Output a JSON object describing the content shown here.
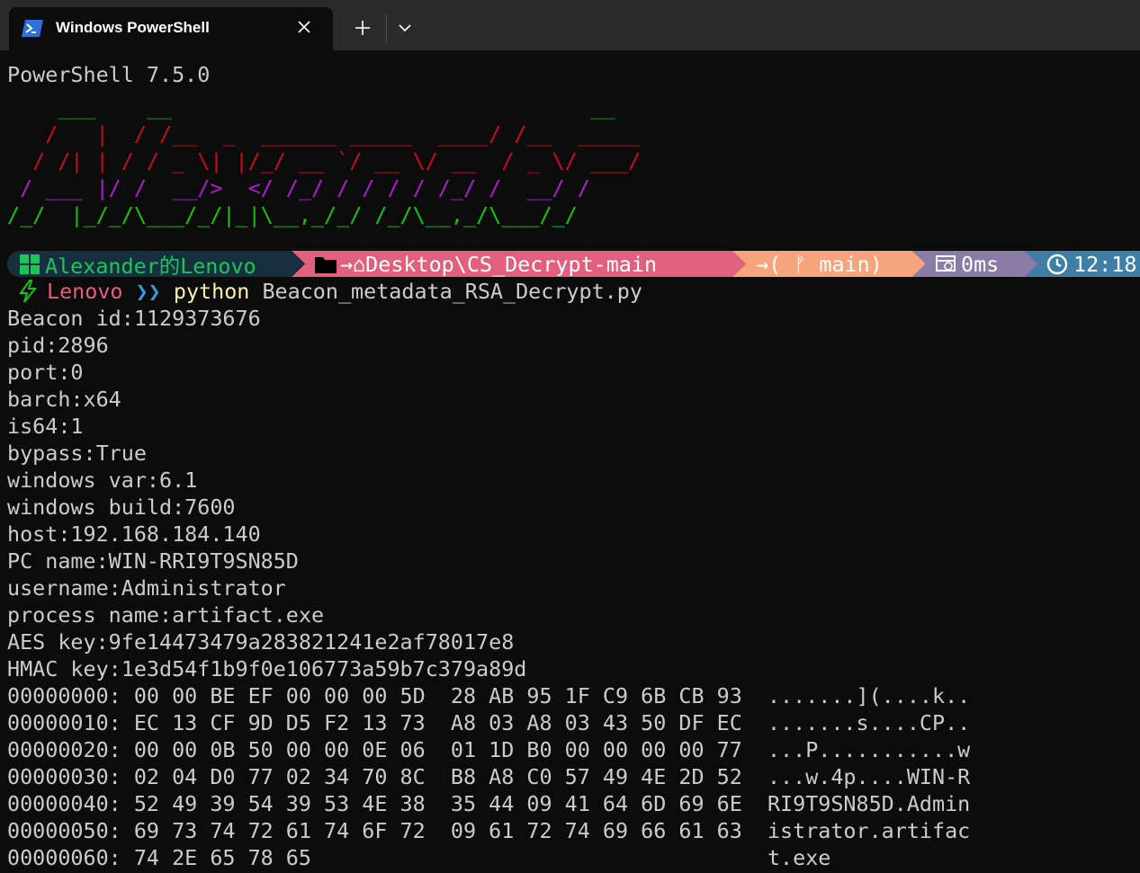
{
  "window": {
    "tab_title": "Windows PowerShell",
    "new_tab_label": "+",
    "tab_icon": "powershell-icon",
    "close_icon": "close-icon",
    "dropdown_icon": "chevron-down-icon"
  },
  "terminal": {
    "version_line": "PowerShell 7.5.0",
    "ascii_art": [
      "    ___    __                                 __",
      "   /   |  / /__  _  ______ _____  ____/ /__  _____",
      "  / /| | / / _ \\| |/_/ __ `/ __ \\/ __  / _ \\/ ___/",
      " / ___ |/ /  __/>  </ /_/ / / / / /_/ /  __/ /",
      "/_/  |_/_/\\___/_/|_|\\__,_/_/ /_/\\__,_/\\___/_/"
    ],
    "ascii_art_colors": [
      "#13a10e",
      "#c50f1f",
      "#c50f1f",
      "#b01cd0",
      "#16c60c"
    ],
    "prompt_bar": {
      "user": "Alexander的Lenovo",
      "path": "→⌂Desktop\\CS_Decrypt-main",
      "git": "→( ᚠ main)",
      "duration": "0ms",
      "time": "12:18",
      "colors": {
        "user_bg": "#173040",
        "user_fg": "#1cc55a",
        "path_bg": "#e0607e",
        "git_bg": "#f6a47b",
        "duration_bg": "#8a7ca7",
        "time_bg": "#3f7fa5"
      },
      "icons": [
        "windows-icon",
        "folder-icon",
        "home-icon",
        "git-branch-icon",
        "timer-icon",
        "clock-icon"
      ]
    },
    "prompt": {
      "host": "Lenovo",
      "arrows": "❯❯",
      "command": "python",
      "argument": "Beacon_metadata_RSA_Decrypt.py",
      "icon": "lightning-icon"
    },
    "output_lines": [
      "Beacon id:1129373676",
      "pid:2896",
      "port:0",
      "barch:x64",
      "is64:1",
      "bypass:True",
      "windows var:6.1",
      "windows build:7600",
      "host:192.168.184.140",
      "PC name:WIN-RRI9T9SN85D",
      "username:Administrator",
      "process name:artifact.exe",
      "AES key:9fe14473479a283821241e2af78017e8",
      "HMAC key:1e3d54f1b9f0e106773a59b7c379a89d",
      "00000000: 00 00 BE EF 00 00 00 5D  28 AB 95 1F C9 6B CB 93  .......](....k..",
      "00000010: EC 13 CF 9D D5 F2 13 73  A8 03 A8 03 43 50 DF EC  .......s....CP..",
      "00000020: 00 00 0B 50 00 00 0E 06  01 1D B0 00 00 00 00 77  ...P...........w",
      "00000030: 02 04 D0 77 02 34 70 8C  B8 A8 C0 57 49 4E 2D 52  ...w.4p....WIN-R",
      "00000040: 52 49 39 54 39 53 4E 38  35 44 09 41 64 6D 69 6E  RI9T9SN85D.Admin",
      "00000050: 69 73 74 72 61 74 6F 72  09 61 72 74 69 66 61 63  istrator.artifac",
      "00000060: 74 2E 65 78 65                                    t.exe"
    ]
  }
}
